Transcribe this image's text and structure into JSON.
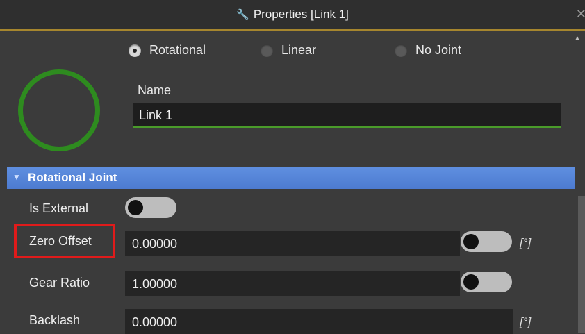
{
  "title": "Properties [Link 1]",
  "joint_types": [
    {
      "label": "Rotational",
      "selected": true
    },
    {
      "label": "Linear",
      "selected": false
    },
    {
      "label": "No Joint",
      "selected": false
    }
  ],
  "name": {
    "label": "Name",
    "value": "Link 1"
  },
  "section": {
    "label": "Rotational Joint"
  },
  "rows": {
    "is_external": {
      "label": "Is External",
      "toggle": "off"
    },
    "zero_offset": {
      "label": "Zero Offset",
      "value": "0.00000",
      "unit": "[°]",
      "toggle": "off"
    },
    "gear_ratio": {
      "label": "Gear Ratio",
      "value": "1.00000",
      "toggle": "off"
    },
    "backlash": {
      "label": "Backlash",
      "value": "0.00000",
      "unit": "[°]"
    }
  },
  "colors": {
    "accent_ring": "#2e8b1f",
    "section_header": "#5a88dc",
    "highlight": "#e01b1b",
    "title_border": "#a6862e"
  },
  "icons": {
    "title": "wrench-icon",
    "close": "close-icon"
  }
}
